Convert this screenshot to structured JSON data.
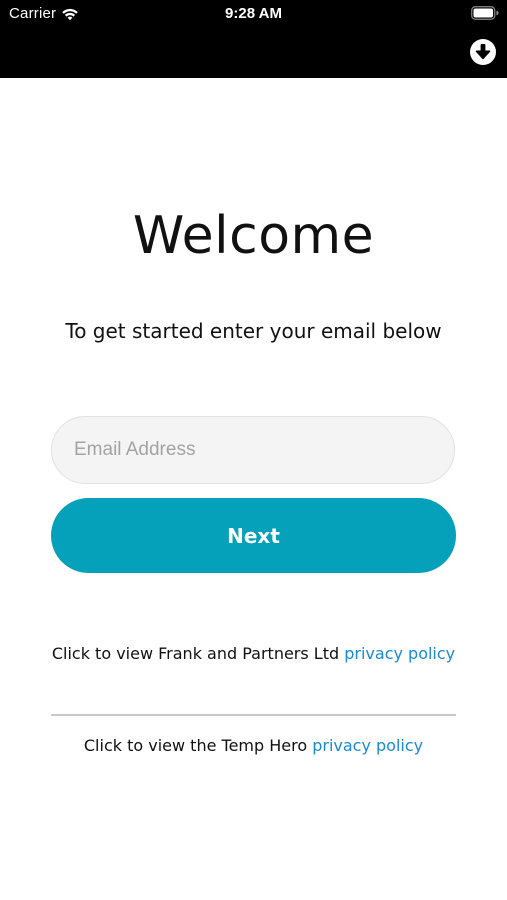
{
  "status_bar": {
    "carrier": "Carrier",
    "time": "9:28 AM",
    "wifi_icon": "wifi-icon",
    "battery_icon": "battery-icon"
  },
  "nav": {
    "download_icon": "download-circle-icon"
  },
  "welcome": {
    "title": "Welcome",
    "subtitle": "To get started enter your email below"
  },
  "form": {
    "email_placeholder": "Email Address",
    "email_value": "",
    "next_label": "Next"
  },
  "privacy": {
    "line1_prefix": "Click to view Frank and Partners Ltd ",
    "line1_link": "privacy policy",
    "line2_prefix": "Click to view the Temp Hero ",
    "line2_link": "privacy policy"
  },
  "colors": {
    "accent": "#05a0b9",
    "link": "#1a8ad6",
    "topbar": "#000000"
  }
}
